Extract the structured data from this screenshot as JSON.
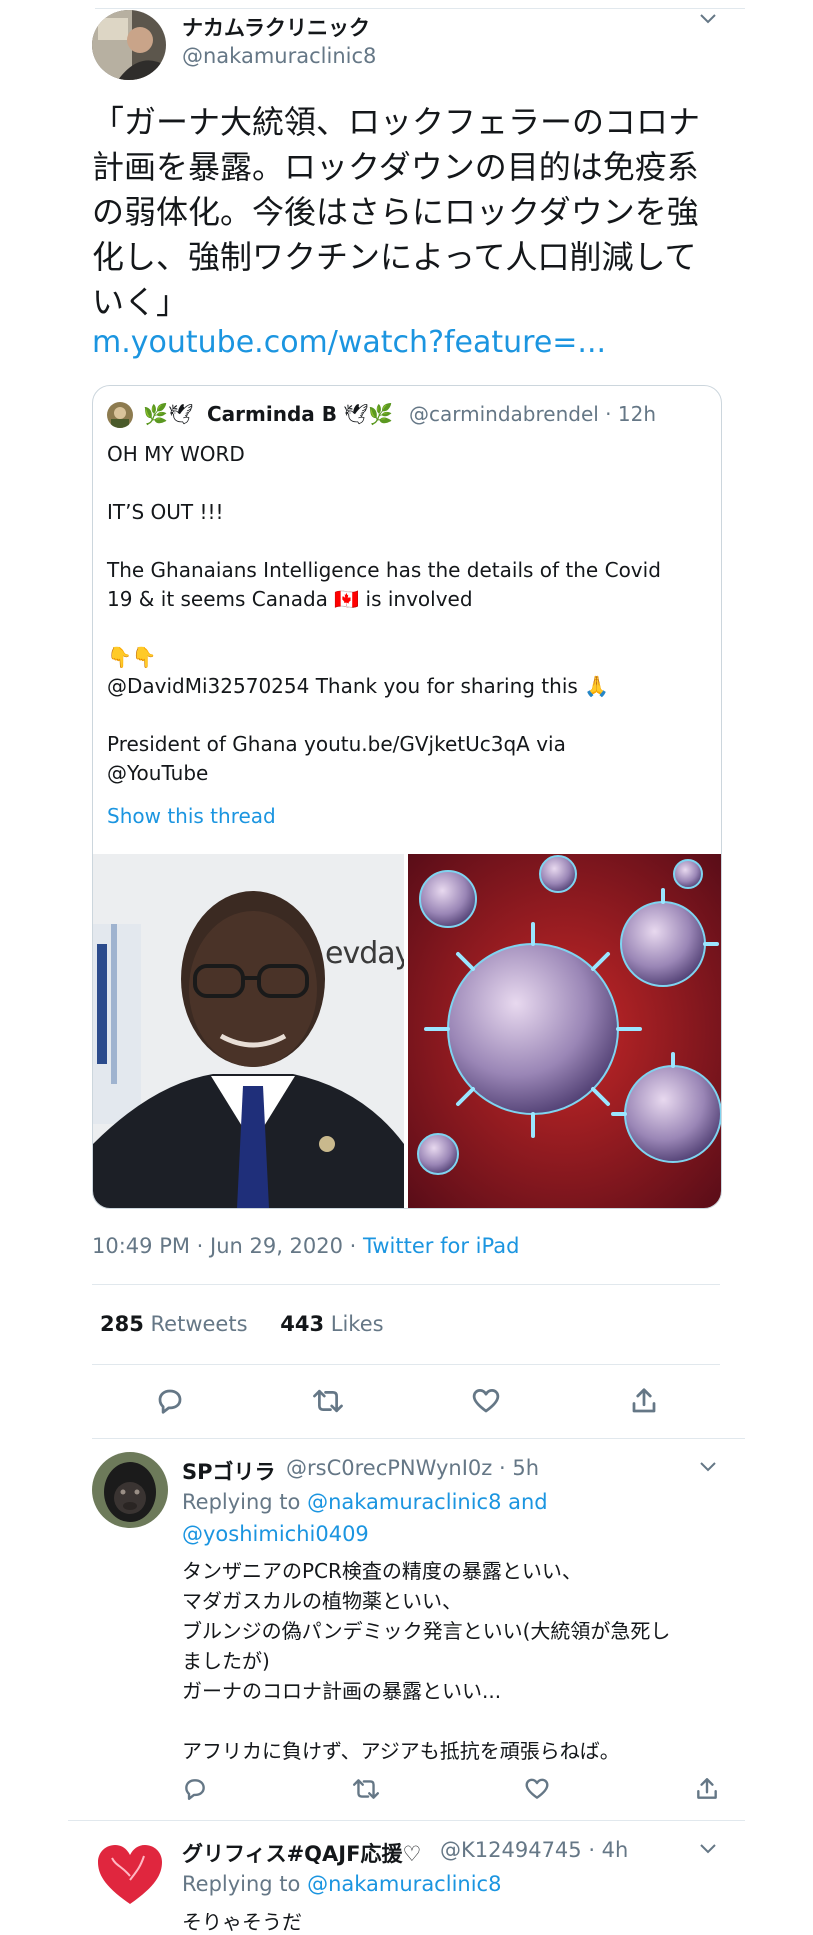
{
  "tweet": {
    "author_name": "ナカムラクリニック",
    "author_handle": "@nakamuraclinic8",
    "text_lines": [
      "「ガーナ大統領、ロックフェラーのコロナ",
      "計画を暴露。ロックダウンの目的は免疫系",
      "の弱体化。今後はさらにロックダウンを強",
      "化し、強制ワクチンによって人口削減して",
      "いく」"
    ],
    "link": "m.youtube.com/watch?feature=...",
    "timestamp": "10:49 PM · Jun 29, 2020 · ",
    "client": "Twitter for iPad",
    "retweets_count": "285",
    "retweets_label": "Retweets",
    "likes_count": "443",
    "likes_label": "Likes"
  },
  "quoted": {
    "name_prefix": "🌿🕊",
    "name": "Carminda B",
    "name_suffix": "🕊🌿",
    "handle_time": "@carmindabrendel · 12h",
    "lines": [
      "OH MY WORD",
      "IT’S OUT !!!",
      "The Ghanaians Intelligence has the details of the Covid",
      "19 & it seems Canada 🇨🇦 is involved",
      "👇👇",
      "@DavidMi32570254 Thank you for sharing this 🙏",
      "President of Ghana youtu.be/GVjketUc3qA via",
      "@YouTube"
    ],
    "show_thread": "Show this thread",
    "image_left_sign": "evdays"
  },
  "replies": [
    {
      "name": "SPゴリラ",
      "handle_time": "@rsC0recPNWynI0z · 5h",
      "replying_prefix": "Replying to ",
      "replying_1": "@nakamuraclinic8 and",
      "replying_2": "@yoshimichi0409",
      "lines": [
        "タンザニアのPCR検査の精度の暴露といい、",
        "マダガスカルの植物薬といい、",
        "ブルンジの偽パンデミック発言といい(大統領が急死し",
        "ましたが)",
        "ガーナのコロナ計画の暴露といい...",
        "アフリカに負けず、アジアも抵抗を頑張らねば。"
      ]
    },
    {
      "name": "グリフィス#QAJF応援♡",
      "handle_time": "@K12494745 · 4h",
      "replying_prefix": "Replying to ",
      "replying_1": "@nakamuraclinic8",
      "lines": [
        "そりゃそうだ"
      ]
    }
  ],
  "colors": {
    "link": "#1b95e0",
    "secondary": "#657786",
    "border": "#e1e8ed"
  },
  "icons": [
    "reply-icon",
    "retweet-icon",
    "like-icon",
    "share-icon",
    "chevron-down-icon"
  ]
}
